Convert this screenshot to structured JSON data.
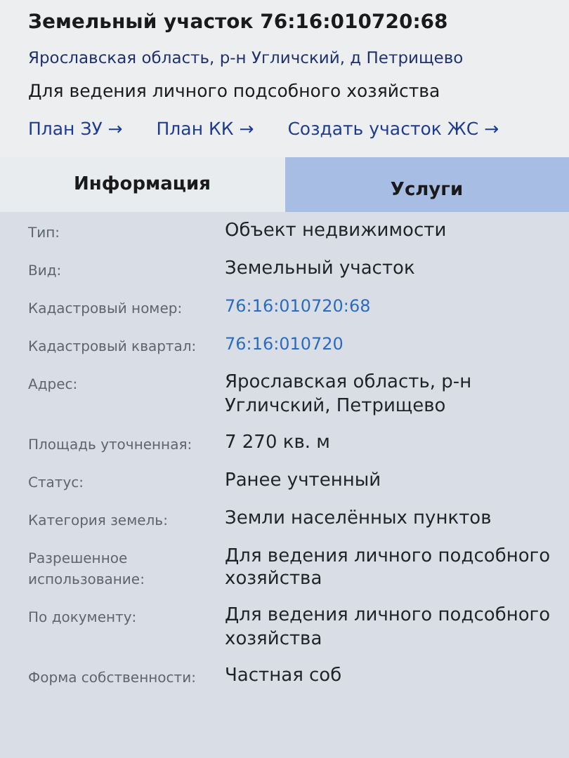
{
  "header": {
    "title": "Земельный участок 76:16:010720:68",
    "address": "Ярославская область, р-н Угличский, д Петрищево",
    "purpose": "Для ведения личного подсобного хозяйства",
    "links": [
      "План ЗУ →",
      "План КК →",
      "Создать участок ЖС →"
    ]
  },
  "tabs": [
    {
      "label": "Информация",
      "selected": true
    },
    {
      "label": "Услуги",
      "selected": false
    }
  ],
  "fields": [
    {
      "label": "Тип:",
      "value": "Объект недвижимости",
      "kind": "text"
    },
    {
      "label": "Вид:",
      "value": "Земельный участок",
      "kind": "text"
    },
    {
      "label": "Кадастровый номер:",
      "value": "76:16:010720:68",
      "kind": "link"
    },
    {
      "label": "Кадастровый квартал:",
      "value": "76:16:010720",
      "kind": "link"
    },
    {
      "label": "Адрес:",
      "value": "Ярославская область, р-н Угличский, Петрищево",
      "kind": "text"
    },
    {
      "label": "Площадь уточненная:",
      "value": "7 270 кв. м",
      "kind": "text"
    },
    {
      "label": "Статус:",
      "value": "Ранее учтенный",
      "kind": "text"
    },
    {
      "label": "Категория земель:",
      "value": "Земли населённых пунктов",
      "kind": "text"
    },
    {
      "label": "Разрешенное использование:",
      "value": "Для ведения личного подсобного хозяйства",
      "kind": "text"
    },
    {
      "label": "По документу:",
      "value": "Для ведения личного подсобного хозяйства",
      "kind": "text"
    },
    {
      "label": "Форма собственности:",
      "value": "Частная соб",
      "kind": "text"
    }
  ]
}
